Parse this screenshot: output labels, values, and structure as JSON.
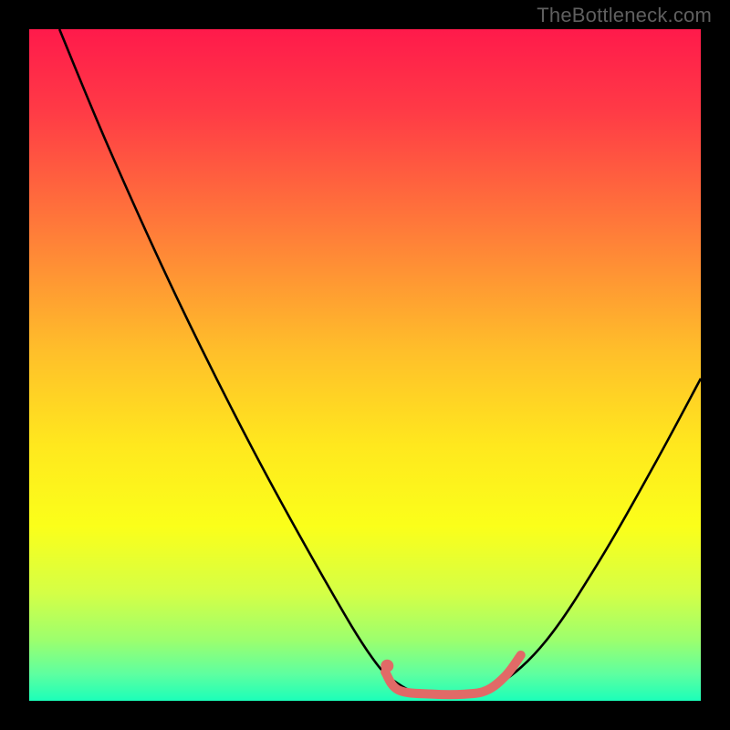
{
  "attribution": "TheBottleneck.com",
  "chart_data": {
    "type": "line",
    "title": "",
    "xlabel": "",
    "ylabel": "",
    "xlim": [
      0,
      100
    ],
    "ylim": [
      0,
      100
    ],
    "gradient_stops": [
      {
        "offset": 0.0,
        "color": "#ff1a4b"
      },
      {
        "offset": 0.12,
        "color": "#ff3a46"
      },
      {
        "offset": 0.3,
        "color": "#ff7c39"
      },
      {
        "offset": 0.48,
        "color": "#ffbf2a"
      },
      {
        "offset": 0.62,
        "color": "#ffe81e"
      },
      {
        "offset": 0.74,
        "color": "#fbff1a"
      },
      {
        "offset": 0.84,
        "color": "#d4ff46"
      },
      {
        "offset": 0.91,
        "color": "#9cff6e"
      },
      {
        "offset": 0.96,
        "color": "#5effa0"
      },
      {
        "offset": 1.0,
        "color": "#1bffb9"
      }
    ],
    "series": [
      {
        "name": "bottleneck-curve",
        "color": "#000000",
        "width": 2.6,
        "points": [
          {
            "x": 4.5,
            "y": 100.0
          },
          {
            "x": 12.0,
            "y": 82.0
          },
          {
            "x": 22.0,
            "y": 60.0
          },
          {
            "x": 33.0,
            "y": 38.0
          },
          {
            "x": 44.0,
            "y": 18.0
          },
          {
            "x": 51.0,
            "y": 6.5
          },
          {
            "x": 55.0,
            "y": 2.5
          },
          {
            "x": 59.0,
            "y": 1.0
          },
          {
            "x": 65.0,
            "y": 1.0
          },
          {
            "x": 70.0,
            "y": 2.5
          },
          {
            "x": 77.0,
            "y": 9.0
          },
          {
            "x": 85.0,
            "y": 21.0
          },
          {
            "x": 93.0,
            "y": 35.0
          },
          {
            "x": 100.0,
            "y": 48.0
          }
        ]
      },
      {
        "name": "optimal-zone-marker",
        "color": "#e16a67",
        "width": 10,
        "linecap": "round",
        "points": [
          {
            "x": 53.0,
            "y": 4.3
          },
          {
            "x": 55.0,
            "y": 1.6
          },
          {
            "x": 60.0,
            "y": 1.0
          },
          {
            "x": 65.0,
            "y": 1.0
          },
          {
            "x": 68.2,
            "y": 1.6
          },
          {
            "x": 71.0,
            "y": 3.8
          },
          {
            "x": 73.2,
            "y": 6.8
          }
        ]
      },
      {
        "name": "marker-dot",
        "type": "point",
        "color": "#e16a67",
        "radius": 7,
        "x": 53.3,
        "y": 5.2
      }
    ]
  }
}
